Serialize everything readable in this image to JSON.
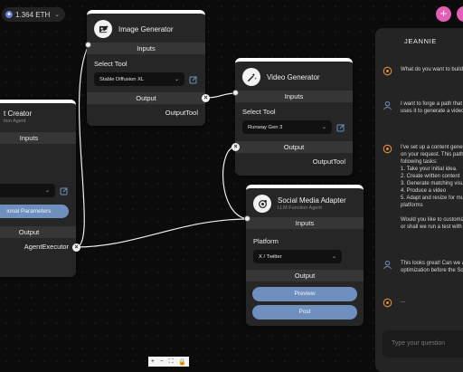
{
  "wallet": {
    "balance": "1.364 ETH"
  },
  "nodes": {
    "agent_creator": {
      "title": "t Creator",
      "subtitle": "tion Agent",
      "inputs_label": "Inputs",
      "additional_params_label": "ional Parameters",
      "output_label": "Output",
      "output_value": "AgentExecutor"
    },
    "image_generator": {
      "title": "Image Generator",
      "inputs_label": "Inputs",
      "select_label": "Select Tool",
      "selected_tool": "Stable Diffusion XL",
      "output_label": "Output",
      "output_value": "OutputTool"
    },
    "video_generator": {
      "title": "Video Generator",
      "inputs_label": "Inputs",
      "select_label": "Select Tool",
      "selected_tool": "Runway Gen 3",
      "output_label": "Output",
      "output_value": "OutputTool"
    },
    "social_media": {
      "title": "Social Media Adapter",
      "subtitle": "LLM Function Agent",
      "inputs_label": "Inputs",
      "platform_label": "Platform",
      "selected_platform": "X / Twitter",
      "output_label": "Output",
      "preview_label": "Preview",
      "post_label": "Post"
    }
  },
  "chat": {
    "title": "JEANNIE",
    "messages": [
      {
        "role": "assistant",
        "lines": [
          "What do you want to build"
        ]
      },
      {
        "role": "user",
        "lines": [
          "I want to forge a path that",
          "uses it to generate a video"
        ]
      },
      {
        "role": "assistant",
        "lines": [
          "I've set up a content gener",
          "on your request. This path",
          "following tasks:",
          "1. Take your initial idea.",
          "2. Create written content",
          "3. Generate matching visu",
          "4. Produce a video",
          "5. Adapt and resize for mu",
          "    platforms",
          "",
          "Would you like to customiz",
          "or shall we run a test with"
        ]
      },
      {
        "role": "user",
        "lines": [
          "This looks great! Can we a",
          "optimization before the So"
        ]
      },
      {
        "role": "assistant",
        "lines": [
          "..."
        ]
      }
    ],
    "input_placeholder": "Type your question"
  },
  "zoom_controls": {
    "zoom_in": "+",
    "zoom_out": "−",
    "fit": "⛶",
    "lock": "🔒"
  },
  "colors": {
    "accent_pink": "#e35fb6",
    "button_blue": "#6f8fbf",
    "chat_icon_orange": "#e08a3c",
    "user_icon_blue": "#6f8fbf"
  }
}
